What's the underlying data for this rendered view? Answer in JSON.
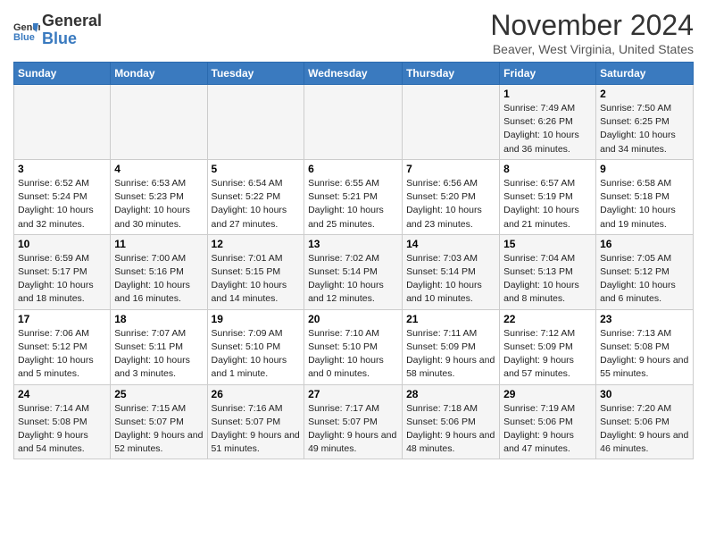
{
  "logo": {
    "line1": "General",
    "line2": "Blue"
  },
  "title": "November 2024",
  "location": "Beaver, West Virginia, United States",
  "weekdays": [
    "Sunday",
    "Monday",
    "Tuesday",
    "Wednesday",
    "Thursday",
    "Friday",
    "Saturday"
  ],
  "weeks": [
    [
      {
        "day": "",
        "info": ""
      },
      {
        "day": "",
        "info": ""
      },
      {
        "day": "",
        "info": ""
      },
      {
        "day": "",
        "info": ""
      },
      {
        "day": "",
        "info": ""
      },
      {
        "day": "1",
        "info": "Sunrise: 7:49 AM\nSunset: 6:26 PM\nDaylight: 10 hours and 36 minutes."
      },
      {
        "day": "2",
        "info": "Sunrise: 7:50 AM\nSunset: 6:25 PM\nDaylight: 10 hours and 34 minutes."
      }
    ],
    [
      {
        "day": "3",
        "info": "Sunrise: 6:52 AM\nSunset: 5:24 PM\nDaylight: 10 hours and 32 minutes."
      },
      {
        "day": "4",
        "info": "Sunrise: 6:53 AM\nSunset: 5:23 PM\nDaylight: 10 hours and 30 minutes."
      },
      {
        "day": "5",
        "info": "Sunrise: 6:54 AM\nSunset: 5:22 PM\nDaylight: 10 hours and 27 minutes."
      },
      {
        "day": "6",
        "info": "Sunrise: 6:55 AM\nSunset: 5:21 PM\nDaylight: 10 hours and 25 minutes."
      },
      {
        "day": "7",
        "info": "Sunrise: 6:56 AM\nSunset: 5:20 PM\nDaylight: 10 hours and 23 minutes."
      },
      {
        "day": "8",
        "info": "Sunrise: 6:57 AM\nSunset: 5:19 PM\nDaylight: 10 hours and 21 minutes."
      },
      {
        "day": "9",
        "info": "Sunrise: 6:58 AM\nSunset: 5:18 PM\nDaylight: 10 hours and 19 minutes."
      }
    ],
    [
      {
        "day": "10",
        "info": "Sunrise: 6:59 AM\nSunset: 5:17 PM\nDaylight: 10 hours and 18 minutes."
      },
      {
        "day": "11",
        "info": "Sunrise: 7:00 AM\nSunset: 5:16 PM\nDaylight: 10 hours and 16 minutes."
      },
      {
        "day": "12",
        "info": "Sunrise: 7:01 AM\nSunset: 5:15 PM\nDaylight: 10 hours and 14 minutes."
      },
      {
        "day": "13",
        "info": "Sunrise: 7:02 AM\nSunset: 5:14 PM\nDaylight: 10 hours and 12 minutes."
      },
      {
        "day": "14",
        "info": "Sunrise: 7:03 AM\nSunset: 5:14 PM\nDaylight: 10 hours and 10 minutes."
      },
      {
        "day": "15",
        "info": "Sunrise: 7:04 AM\nSunset: 5:13 PM\nDaylight: 10 hours and 8 minutes."
      },
      {
        "day": "16",
        "info": "Sunrise: 7:05 AM\nSunset: 5:12 PM\nDaylight: 10 hours and 6 minutes."
      }
    ],
    [
      {
        "day": "17",
        "info": "Sunrise: 7:06 AM\nSunset: 5:12 PM\nDaylight: 10 hours and 5 minutes."
      },
      {
        "day": "18",
        "info": "Sunrise: 7:07 AM\nSunset: 5:11 PM\nDaylight: 10 hours and 3 minutes."
      },
      {
        "day": "19",
        "info": "Sunrise: 7:09 AM\nSunset: 5:10 PM\nDaylight: 10 hours and 1 minute."
      },
      {
        "day": "20",
        "info": "Sunrise: 7:10 AM\nSunset: 5:10 PM\nDaylight: 10 hours and 0 minutes."
      },
      {
        "day": "21",
        "info": "Sunrise: 7:11 AM\nSunset: 5:09 PM\nDaylight: 9 hours and 58 minutes."
      },
      {
        "day": "22",
        "info": "Sunrise: 7:12 AM\nSunset: 5:09 PM\nDaylight: 9 hours and 57 minutes."
      },
      {
        "day": "23",
        "info": "Sunrise: 7:13 AM\nSunset: 5:08 PM\nDaylight: 9 hours and 55 minutes."
      }
    ],
    [
      {
        "day": "24",
        "info": "Sunrise: 7:14 AM\nSunset: 5:08 PM\nDaylight: 9 hours and 54 minutes."
      },
      {
        "day": "25",
        "info": "Sunrise: 7:15 AM\nSunset: 5:07 PM\nDaylight: 9 hours and 52 minutes."
      },
      {
        "day": "26",
        "info": "Sunrise: 7:16 AM\nSunset: 5:07 PM\nDaylight: 9 hours and 51 minutes."
      },
      {
        "day": "27",
        "info": "Sunrise: 7:17 AM\nSunset: 5:07 PM\nDaylight: 9 hours and 49 minutes."
      },
      {
        "day": "28",
        "info": "Sunrise: 7:18 AM\nSunset: 5:06 PM\nDaylight: 9 hours and 48 minutes."
      },
      {
        "day": "29",
        "info": "Sunrise: 7:19 AM\nSunset: 5:06 PM\nDaylight: 9 hours and 47 minutes."
      },
      {
        "day": "30",
        "info": "Sunrise: 7:20 AM\nSunset: 5:06 PM\nDaylight: 9 hours and 46 minutes."
      }
    ]
  ]
}
